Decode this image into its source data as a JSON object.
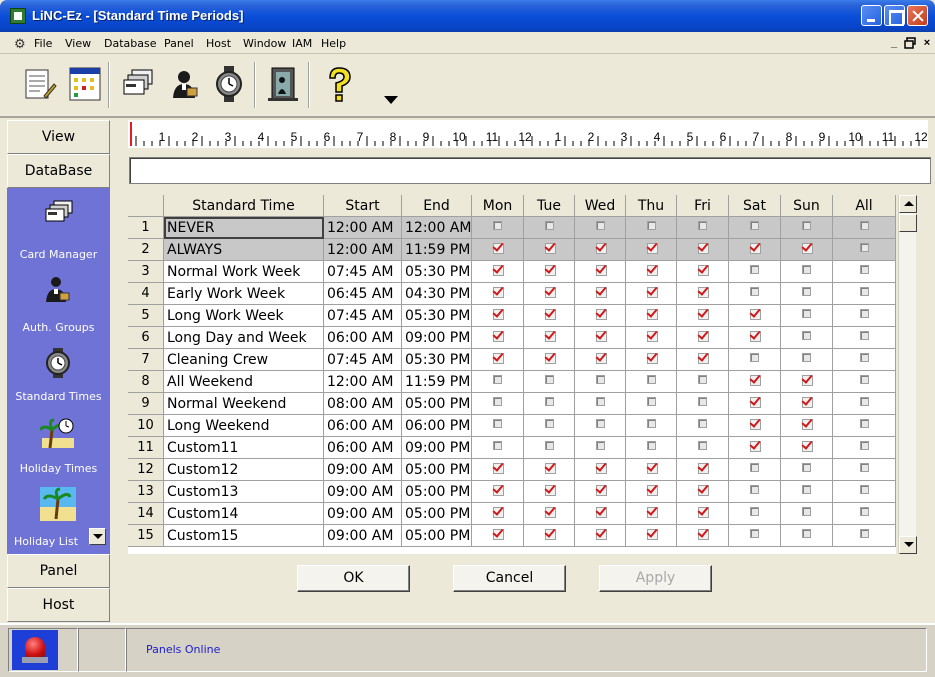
{
  "window": {
    "title": "LiNC-Ez - [Standard Time Periods]"
  },
  "menu": {
    "items": [
      "File",
      "View",
      "Database",
      "Panel",
      "Host",
      "Window",
      "IAM",
      "Help"
    ],
    "mdi_buttons": [
      "_",
      "ð",
      "×"
    ]
  },
  "toolbar": {
    "icons": [
      "notepad-icon",
      "calendar-icon",
      "card-stack-icon",
      "user-icon",
      "clock-icon",
      "door-icon",
      "help-icon"
    ]
  },
  "sidebar": {
    "view_label": "View",
    "database_label": "DataBase",
    "panel_label": "Panel",
    "host_label": "Host",
    "items": [
      {
        "label": "Card Manager",
        "icon": "card-stack-icon"
      },
      {
        "label": "Auth. Groups",
        "icon": "user-icon"
      },
      {
        "label": "Standard Times",
        "icon": "clock-icon"
      },
      {
        "label": "Holiday Times",
        "icon": "holiday-clock-icon"
      },
      {
        "label": "Holiday List",
        "icon": "palm-tree-icon"
      }
    ]
  },
  "ruler": {
    "labels": [
      "1",
      "2",
      "3",
      "4",
      "5",
      "6",
      "7",
      "8",
      "9",
      "10",
      "11",
      "12",
      "1",
      "2",
      "3",
      "4",
      "5",
      "6",
      "7",
      "8",
      "9",
      "10",
      "11",
      "12"
    ]
  },
  "table": {
    "columns": [
      "Standard Time",
      "Start",
      "End",
      "Mon",
      "Tue",
      "Wed",
      "Thu",
      "Fri",
      "Sat",
      "Sun",
      "All"
    ],
    "rows": [
      {
        "num": "1",
        "name": "NEVER",
        "start": "12:00 AM",
        "end": "12:00 AM",
        "days": [
          0,
          0,
          0,
          0,
          0,
          0,
          0,
          0
        ]
      },
      {
        "num": "2",
        "name": "ALWAYS",
        "start": "12:00 AM",
        "end": "11:59 PM",
        "days": [
          1,
          1,
          1,
          1,
          1,
          1,
          1,
          0
        ]
      },
      {
        "num": "3",
        "name": "Normal Work Week",
        "start": "07:45 AM",
        "end": "05:30 PM",
        "days": [
          1,
          1,
          1,
          1,
          1,
          0,
          0,
          0
        ]
      },
      {
        "num": "4",
        "name": "Early Work Week",
        "start": "06:45 AM",
        "end": "04:30 PM",
        "days": [
          1,
          1,
          1,
          1,
          1,
          0,
          0,
          0
        ]
      },
      {
        "num": "5",
        "name": "Long Work Week",
        "start": "07:45 AM",
        "end": "05:30 PM",
        "days": [
          1,
          1,
          1,
          1,
          1,
          1,
          0,
          0
        ]
      },
      {
        "num": "6",
        "name": "Long Day and Week",
        "start": "06:00 AM",
        "end": "09:00 PM",
        "days": [
          1,
          1,
          1,
          1,
          1,
          1,
          0,
          0
        ]
      },
      {
        "num": "7",
        "name": "Cleaning Crew",
        "start": "07:45 AM",
        "end": "05:30 PM",
        "days": [
          1,
          1,
          1,
          1,
          1,
          0,
          0,
          0
        ]
      },
      {
        "num": "8",
        "name": "All Weekend",
        "start": "12:00 AM",
        "end": "11:59 PM",
        "days": [
          0,
          0,
          0,
          0,
          0,
          1,
          1,
          0
        ]
      },
      {
        "num": "9",
        "name": "Normal Weekend",
        "start": "08:00 AM",
        "end": "05:00 PM",
        "days": [
          0,
          0,
          0,
          0,
          0,
          1,
          1,
          0
        ]
      },
      {
        "num": "10",
        "name": "Long Weekend",
        "start": "06:00 AM",
        "end": "06:00 PM",
        "days": [
          0,
          0,
          0,
          0,
          0,
          1,
          1,
          0
        ]
      },
      {
        "num": "11",
        "name": "Custom11",
        "start": "06:00 AM",
        "end": "09:00 PM",
        "days": [
          0,
          0,
          0,
          0,
          0,
          1,
          1,
          0
        ]
      },
      {
        "num": "12",
        "name": "Custom12",
        "start": "09:00 AM",
        "end": "05:00 PM",
        "days": [
          1,
          1,
          1,
          1,
          1,
          0,
          0,
          0
        ]
      },
      {
        "num": "13",
        "name": "Custom13",
        "start": "09:00 AM",
        "end": "05:00 PM",
        "days": [
          1,
          1,
          1,
          1,
          1,
          0,
          0,
          0
        ]
      },
      {
        "num": "14",
        "name": "Custom14",
        "start": "09:00 AM",
        "end": "05:00 PM",
        "days": [
          1,
          1,
          1,
          1,
          1,
          0,
          0,
          0
        ]
      },
      {
        "num": "15",
        "name": "Custom15",
        "start": "09:00 AM",
        "end": "05:00 PM",
        "days": [
          1,
          1,
          1,
          1,
          1,
          0,
          0,
          0
        ]
      }
    ]
  },
  "buttons": {
    "ok": "OK",
    "cancel": "Cancel",
    "apply": "Apply"
  },
  "status": {
    "text": "Panels Online"
  },
  "colors": {
    "titlebar": "#0a4fd9",
    "sidebar_panel": "#6f73d5",
    "check": "#d01818",
    "status_text": "#1c1cd0"
  }
}
